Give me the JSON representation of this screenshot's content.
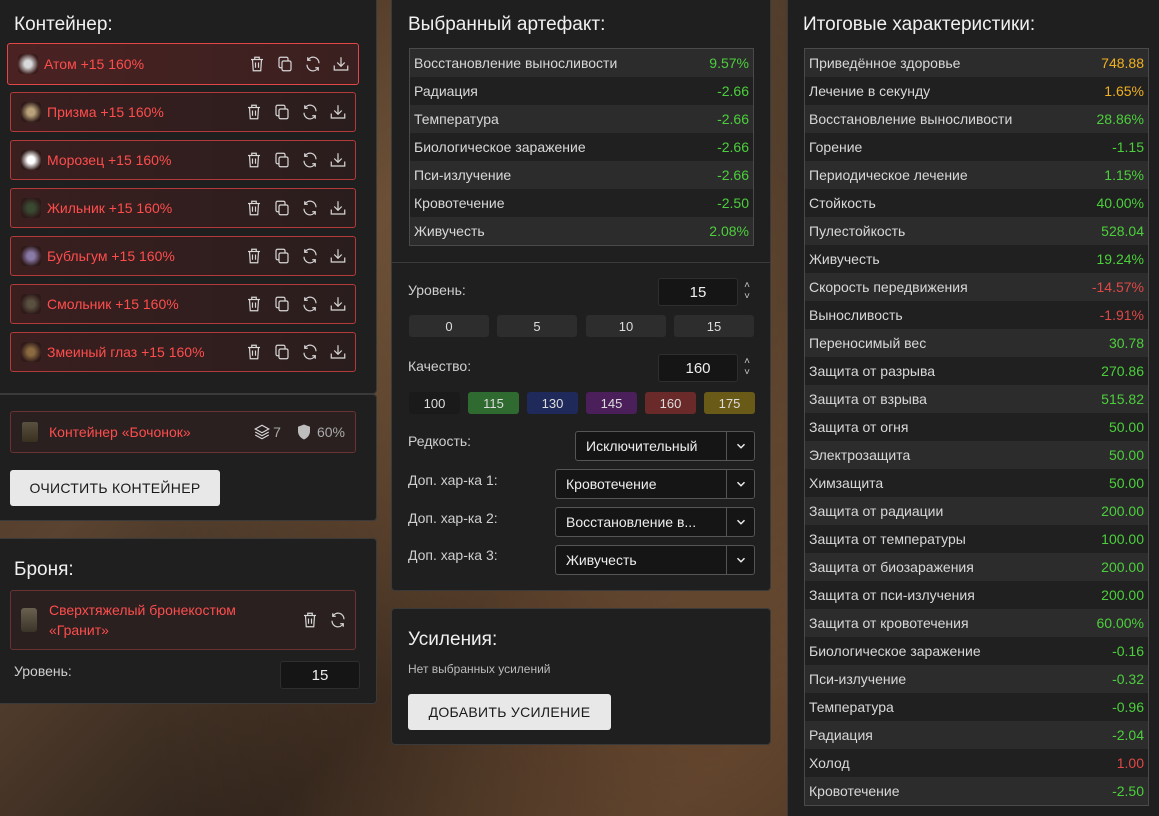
{
  "container": {
    "title": "Контейнер:",
    "artifacts": [
      {
        "label": "Атом +15 160%",
        "thumb_color": "#d9d9d9"
      },
      {
        "label": "Призма +15 160%",
        "thumb_color": "#b8a27a"
      },
      {
        "label": "Морозец +15 160%",
        "thumb_color": "#ffffff"
      },
      {
        "label": "Жильник +15 160%",
        "thumb_color": "#3a4a32"
      },
      {
        "label": "Бубльгум +15 160%",
        "thumb_color": "#8a7aa8"
      },
      {
        "label": "Смольник +15 160%",
        "thumb_color": "#5a5040"
      },
      {
        "label": "Змеиный глаз +15 160%",
        "thumb_color": "#8a6a40"
      }
    ],
    "box_name": "Контейнер «Бочонок»",
    "box_slots": "7",
    "box_protection": "60%",
    "clear_button": "ОЧИСТИТЬ КОНТЕЙНЕР"
  },
  "armor": {
    "title": "Броня:",
    "name_line1": "Сверхтяжелый бронекостюм",
    "name_line2": "«Гранит»",
    "level_label": "Уровень:",
    "level_value": "15"
  },
  "artifact": {
    "title": "Выбранный артефакт:",
    "stats": [
      {
        "name": "Восстановление выносливости",
        "value": "9.57%",
        "color": "green"
      },
      {
        "name": "Радиация",
        "value": "-2.66",
        "color": "green"
      },
      {
        "name": "Температура",
        "value": "-2.66",
        "color": "green"
      },
      {
        "name": "Биологическое заражение",
        "value": "-2.66",
        "color": "green"
      },
      {
        "name": "Пси-излучение",
        "value": "-2.66",
        "color": "green"
      },
      {
        "name": "Кровотечение",
        "value": "-2.50",
        "color": "green"
      },
      {
        "name": "Живучесть",
        "value": "2.08%",
        "color": "green"
      }
    ],
    "level_label": "Уровень:",
    "level_value": "15",
    "level_presets": [
      "0",
      "5",
      "10",
      "15"
    ],
    "quality_label": "Качество:",
    "quality_value": "160",
    "quality_presets": [
      {
        "label": "100",
        "color": "#1a1a1a"
      },
      {
        "label": "115",
        "color": "#2f6a30"
      },
      {
        "label": "130",
        "color": "#1f2a5a"
      },
      {
        "label": "145",
        "color": "#4a1f5a"
      },
      {
        "label": "160",
        "color": "#6a2a2a"
      },
      {
        "label": "175",
        "color": "#6a5a18"
      }
    ],
    "rarity_label": "Редкость:",
    "rarity_value": "Исключительный",
    "extra1_label": "Доп. хар-ка 1:",
    "extra1_value": "Кровотечение",
    "extra2_label": "Доп. хар-ка 2:",
    "extra2_value": "Восстановление в...",
    "extra3_label": "Доп. хар-ка 3:",
    "extra3_value": "Живучесть"
  },
  "boosts": {
    "title": "Усиления:",
    "empty_text": "Нет выбранных усилений",
    "add_button": "ДОБАВИТЬ УСИЛЕНИЕ"
  },
  "totals": {
    "title": "Итоговые характеристики:",
    "stats": [
      {
        "name": "Приведённое здоровье",
        "value": "748.88",
        "color": "orange"
      },
      {
        "name": "Лечение в секунду",
        "value": "1.65%",
        "color": "orange"
      },
      {
        "name": "Восстановление выносливости",
        "value": "28.86%",
        "color": "green"
      },
      {
        "name": "Горение",
        "value": "-1.15",
        "color": "green"
      },
      {
        "name": "Периодическое лечение",
        "value": "1.15%",
        "color": "green"
      },
      {
        "name": "Стойкость",
        "value": "40.00%",
        "color": "green"
      },
      {
        "name": "Пулестойкость",
        "value": "528.04",
        "color": "green"
      },
      {
        "name": "Живучесть",
        "value": "19.24%",
        "color": "green"
      },
      {
        "name": "Скорость передвижения",
        "value": "-14.57%",
        "color": "red"
      },
      {
        "name": "Выносливость",
        "value": "-1.91%",
        "color": "red"
      },
      {
        "name": "Переносимый вес",
        "value": "30.78",
        "color": "green"
      },
      {
        "name": "Защита от разрыва",
        "value": "270.86",
        "color": "green"
      },
      {
        "name": "Защита от взрыва",
        "value": "515.82",
        "color": "green"
      },
      {
        "name": "Защита от огня",
        "value": "50.00",
        "color": "green"
      },
      {
        "name": "Электрозащита",
        "value": "50.00",
        "color": "green"
      },
      {
        "name": "Химзащита",
        "value": "50.00",
        "color": "green"
      },
      {
        "name": "Защита от радиации",
        "value": "200.00",
        "color": "green"
      },
      {
        "name": "Защита от температуры",
        "value": "100.00",
        "color": "green"
      },
      {
        "name": "Защита от биозаражения",
        "value": "200.00",
        "color": "green"
      },
      {
        "name": "Защита от пси-излучения",
        "value": "200.00",
        "color": "green"
      },
      {
        "name": "Защита от кровотечения",
        "value": "60.00%",
        "color": "green"
      },
      {
        "name": "Биологическое заражение",
        "value": "-0.16",
        "color": "green"
      },
      {
        "name": "Пси-излучение",
        "value": "-0.32",
        "color": "green"
      },
      {
        "name": "Температура",
        "value": "-0.96",
        "color": "green"
      },
      {
        "name": "Радиация",
        "value": "-2.04",
        "color": "green"
      },
      {
        "name": "Холод",
        "value": "1.00",
        "color": "red"
      },
      {
        "name": "Кровотечение",
        "value": "-2.50",
        "color": "green"
      }
    ]
  }
}
